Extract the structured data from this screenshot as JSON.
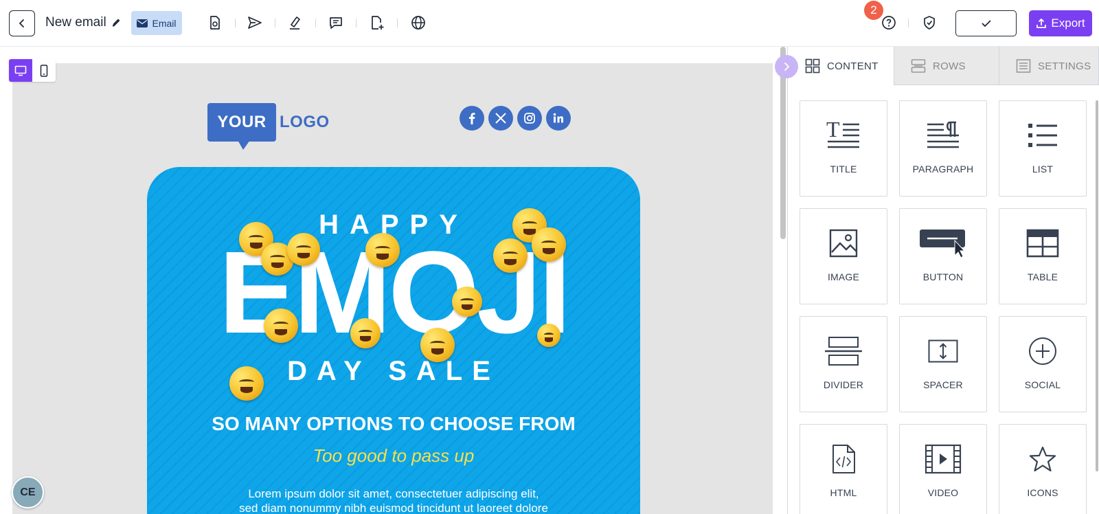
{
  "header": {
    "title": "New email",
    "type_tag": "Email",
    "notification_count": "2",
    "export_label": "Export"
  },
  "email": {
    "logo_box": "YOUR",
    "logo_text": "LOGO",
    "social_icons": [
      "facebook-icon",
      "x-icon",
      "instagram-icon",
      "linkedin-icon"
    ],
    "hero": {
      "happy": "HAPPY",
      "emoji": "EMOJI",
      "day_sale": "DAY SALE",
      "headline": "SO MANY OPTIONS TO CHOOSE FROM",
      "tagline": "Too good to pass up",
      "lorem_line1": "Lorem ipsum dolor sit amet, consectetuer adipiscing elit,",
      "lorem_line2": "sed diam nonummy nibh euismod tincidunt ut laoreet dolore"
    }
  },
  "user": {
    "initials": "CE"
  },
  "panel": {
    "tabs": [
      {
        "label": "CONTENT",
        "active": true
      },
      {
        "label": "ROWS",
        "active": false
      },
      {
        "label": "SETTINGS",
        "active": false
      }
    ],
    "blocks": [
      {
        "label": "TITLE",
        "icon": "title-icon"
      },
      {
        "label": "PARAGRAPH",
        "icon": "paragraph-icon"
      },
      {
        "label": "LIST",
        "icon": "list-icon"
      },
      {
        "label": "IMAGE",
        "icon": "image-icon"
      },
      {
        "label": "BUTTON",
        "icon": "button-icon"
      },
      {
        "label": "TABLE",
        "icon": "table-icon"
      },
      {
        "label": "DIVIDER",
        "icon": "divider-icon"
      },
      {
        "label": "SPACER",
        "icon": "spacer-icon"
      },
      {
        "label": "SOCIAL",
        "icon": "social-icon"
      },
      {
        "label": "HTML",
        "icon": "html-icon"
      },
      {
        "label": "VIDEO",
        "icon": "video-icon"
      },
      {
        "label": "ICONS",
        "icon": "star-icon"
      }
    ]
  },
  "colors": {
    "accent": "#7b3ff2",
    "brand_blue": "#3d6dc4",
    "hero_blue": "#0ea5e9",
    "tagline_yellow": "#f9e04b",
    "badge_red": "#f0614a"
  }
}
